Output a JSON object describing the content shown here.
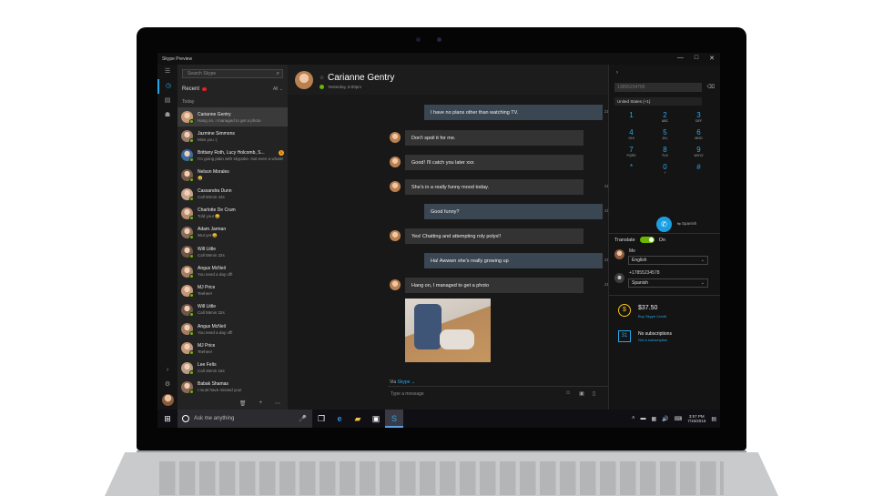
{
  "window": {
    "title": "Skype Preview",
    "min": "—",
    "max": "□",
    "close": "✕"
  },
  "rail": {
    "icons": [
      "menu-icon",
      "recent-chats-icon",
      "contacts-icon",
      "people-icon"
    ],
    "bottom": [
      "chevron-icon",
      "settings-icon"
    ]
  },
  "sidebar": {
    "search_placeholder": "Search Skype",
    "recent_label": "Recent",
    "all_label": "All ⌄",
    "section": "Today",
    "contacts": [
      {
        "name": "Carianne Gentry",
        "mood": "Hang on, I managed to get a photo",
        "color": "#c79a76",
        "selected": true,
        "badge": ""
      },
      {
        "name": "Jazmine Simmons",
        "mood": "Miss you :(",
        "color": "#9b7a6a",
        "selected": false,
        "badge": ""
      },
      {
        "name": "Brittany Roth, Lucy Holcomb, S...",
        "mood": "I'm going plain with skypoke. Not even a whale!",
        "color": "#3b6aa0",
        "selected": false,
        "badge": "1"
      },
      {
        "name": "Nelson Morales",
        "mood": "😀",
        "color": "#7a5a48",
        "selected": false,
        "badge": ""
      },
      {
        "name": "Cassandra Dunn",
        "mood": "Call 50min 43s",
        "color": "#c8a28c",
        "selected": false,
        "badge": ""
      },
      {
        "name": "Charlotte De Crum",
        "mood": "Told you! 😄",
        "color": "#b58a6e",
        "selected": false,
        "badge": ""
      },
      {
        "name": "Adam Jarman",
        "mood": "Wut yet 😄",
        "color": "#8a6b58",
        "selected": false,
        "badge": ""
      },
      {
        "name": "Will Little",
        "mood": "Call 59min 32s",
        "color": "#6e5546",
        "selected": false,
        "badge": ""
      },
      {
        "name": "Angus McNeil",
        "mood": "You need a day off!",
        "color": "#a47d64",
        "selected": false,
        "badge": ""
      },
      {
        "name": "MJ Price",
        "mood": "Teehee!",
        "color": "#c49578",
        "selected": false,
        "badge": ""
      },
      {
        "name": "Will Little",
        "mood": "Call 59min 32s",
        "color": "#6e5546",
        "selected": false,
        "badge": ""
      },
      {
        "name": "Angus McNeil",
        "mood": "You need a day off!",
        "color": "#a47d64",
        "selected": false,
        "badge": ""
      },
      {
        "name": "MJ Price",
        "mood": "Teehee!",
        "color": "#c49578",
        "selected": false,
        "badge": ""
      },
      {
        "name": "Lee Felts",
        "mood": "Call 26min 16s",
        "color": "#b99a84",
        "selected": false,
        "badge": ""
      },
      {
        "name": "Babak Shamas",
        "mood": "I must have missed you!",
        "color": "#8d6a56",
        "selected": false,
        "badge": ""
      }
    ],
    "bottom_icons": [
      "🗑",
      "+",
      "⋯"
    ]
  },
  "chat": {
    "name": "Carianne Gentry",
    "status": "Yesterday, 6:00pm",
    "via_prefix": "Via",
    "via_service": "Skype ⌄",
    "compose_placeholder": "Type a message",
    "messages": [
      {
        "text": "I have no plans other than watching TV.",
        "dir": "out",
        "time": "21"
      },
      {
        "text": "Don't spoil it for me.",
        "dir": "in",
        "time": ""
      },
      {
        "text": "Good! I'll catch you later xxx",
        "dir": "in",
        "time": ""
      },
      {
        "text": "She's in a really funny mood today.",
        "dir": "in",
        "time": "21"
      },
      {
        "text": "Good funny?",
        "dir": "out",
        "time": "21"
      },
      {
        "text": "Yes! Chatting and attempting roly polys!!",
        "dir": "in",
        "time": ""
      },
      {
        "text": "Ha! Awwwn she's really growing up",
        "dir": "out",
        "time": "21"
      },
      {
        "text": "Hang on, I managed to get a photo",
        "dir": "in",
        "time": "21"
      }
    ]
  },
  "dialer": {
    "number_placeholder": "13855234765",
    "country": "United States (+1)",
    "keys": [
      {
        "d": "1",
        "l": ""
      },
      {
        "d": "2",
        "l": "ABC"
      },
      {
        "d": "3",
        "l": "DEF"
      },
      {
        "d": "4",
        "l": "GHI"
      },
      {
        "d": "5",
        "l": "JKL"
      },
      {
        "d": "6",
        "l": "MNO"
      },
      {
        "d": "7",
        "l": "PQRS"
      },
      {
        "d": "8",
        "l": "TUV"
      },
      {
        "d": "9",
        "l": "WXYZ"
      },
      {
        "d": "*",
        "l": ""
      },
      {
        "d": "0",
        "l": "+"
      },
      {
        "d": "#",
        "l": ""
      }
    ],
    "call_lang": "Spanish",
    "translate_label": "Translate",
    "translate_state": "On",
    "me_label": "Me",
    "me_lang": "English",
    "other_number": "+17855234578",
    "other_lang": "Spanish",
    "credit": "$37.50",
    "credit_link": "Buy Skype Credit",
    "subs": "No subscriptions",
    "subs_link": "Get a subscription"
  },
  "taskbar": {
    "search": "Ask me anything",
    "time": "3:57 PM",
    "date": "7/15/2016"
  }
}
